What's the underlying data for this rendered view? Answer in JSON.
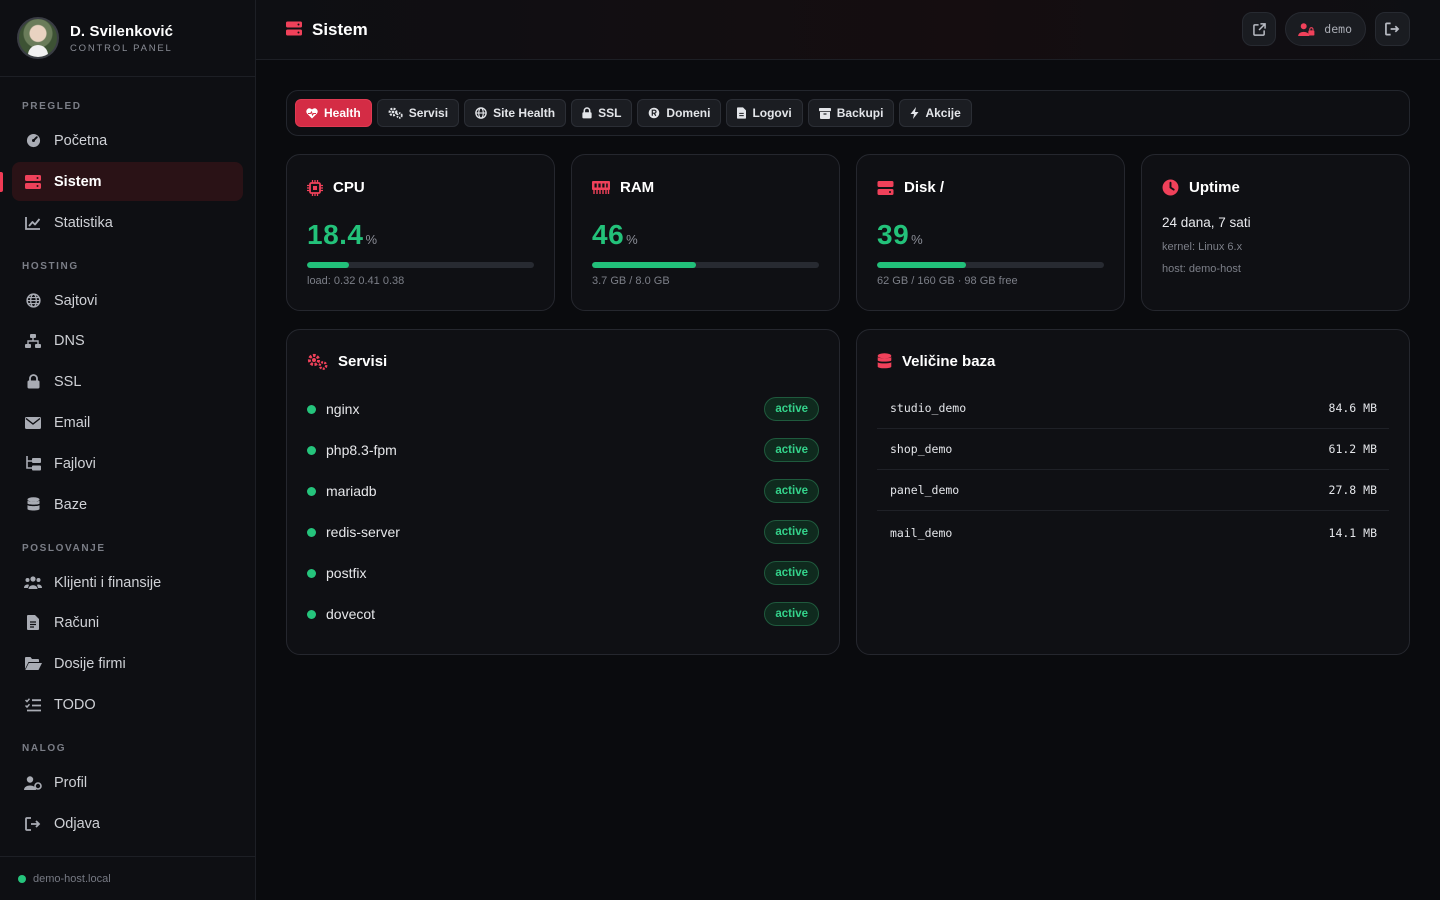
{
  "brand": {
    "name": "D. Svilenković",
    "subtitle": "CONTROL PANEL"
  },
  "sidebar": {
    "sections": [
      {
        "label": "PREGLED",
        "items": [
          {
            "label": "Početna",
            "icon": "dashboard-gauge-icon"
          },
          {
            "label": "Sistem",
            "icon": "server-icon",
            "active": true
          },
          {
            "label": "Statistika",
            "icon": "line-chart-icon"
          }
        ]
      },
      {
        "label": "HOSTING",
        "items": [
          {
            "label": "Sajtovi",
            "icon": "globe-icon"
          },
          {
            "label": "DNS",
            "icon": "network-icon"
          },
          {
            "label": "SSL",
            "icon": "lock-icon"
          },
          {
            "label": "Email",
            "icon": "envelope-icon"
          },
          {
            "label": "Fajlovi",
            "icon": "folder-tree-icon"
          },
          {
            "label": "Baze",
            "icon": "database-icon"
          }
        ]
      },
      {
        "label": "POSLOVANJE",
        "items": [
          {
            "label": "Klijenti i finansije",
            "icon": "users-icon"
          },
          {
            "label": "Računi",
            "icon": "invoice-icon"
          },
          {
            "label": "Dosije firmi",
            "icon": "folder-open-icon"
          },
          {
            "label": "TODO",
            "icon": "list-check-icon"
          }
        ]
      },
      {
        "label": "NALOG",
        "items": [
          {
            "label": "Profil",
            "icon": "user-gear-icon"
          },
          {
            "label": "Odjava",
            "icon": "logout-icon"
          }
        ]
      }
    ],
    "footer_host": "demo-host.local"
  },
  "header": {
    "title": "Sistem",
    "user": "demo"
  },
  "tabs": [
    {
      "label": "Health",
      "icon": "heart-pulse-icon",
      "active": true
    },
    {
      "label": "Servisi",
      "icon": "gears-icon"
    },
    {
      "label": "Site Health",
      "icon": "globe-icon"
    },
    {
      "label": "SSL",
      "icon": "lock-icon"
    },
    {
      "label": "Domeni",
      "icon": "registered-icon"
    },
    {
      "label": "Logovi",
      "icon": "file-icon"
    },
    {
      "label": "Backupi",
      "icon": "archive-icon"
    },
    {
      "label": "Akcije",
      "icon": "bolt-icon"
    }
  ],
  "stats": {
    "cpu": {
      "title": "CPU",
      "value": "18.4",
      "unit": "%",
      "percent": 18.4,
      "meta": "load: 0.32 0.41 0.38"
    },
    "ram": {
      "title": "RAM",
      "value": "46",
      "unit": "%",
      "percent": 46,
      "meta": "3.7 GB / 8.0 GB"
    },
    "disk": {
      "title": "Disk /",
      "value": "39",
      "unit": "%",
      "percent": 39,
      "meta": "62 GB / 160 GB · 98 GB free"
    },
    "uptime": {
      "title": "Uptime",
      "value": "24 dana, 7 sati",
      "kernel": "kernel: Linux 6.x",
      "host": "host: demo-host"
    }
  },
  "services": {
    "title": "Servisi",
    "items": [
      {
        "name": "nginx",
        "status": "active"
      },
      {
        "name": "php8.3-fpm",
        "status": "active"
      },
      {
        "name": "mariadb",
        "status": "active"
      },
      {
        "name": "redis-server",
        "status": "active"
      },
      {
        "name": "postfix",
        "status": "active"
      },
      {
        "name": "dovecot",
        "status": "active"
      }
    ]
  },
  "databases": {
    "title": "Veličine baza",
    "items": [
      {
        "name": "studio_demo",
        "size": "84.6 MB"
      },
      {
        "name": "shop_demo",
        "size": "61.2 MB"
      },
      {
        "name": "panel_demo",
        "size": "27.8 MB"
      },
      {
        "name": "mail_demo",
        "size": "14.1 MB"
      }
    ]
  },
  "colors": {
    "accent": "#ef3b55",
    "success": "#23c27a",
    "background": "#0a0b0e"
  }
}
